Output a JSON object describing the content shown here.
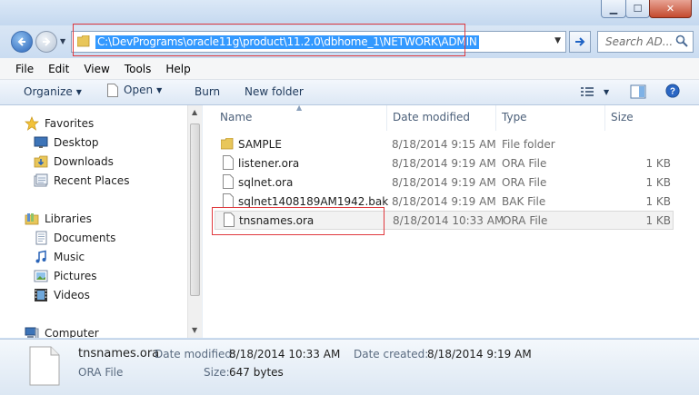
{
  "window": {
    "controls": {
      "minimize": "▁",
      "maximize": "☐",
      "close": "✕"
    }
  },
  "nav": {
    "address": "C:\\DevPrograms\\oracle11g\\product\\11.2.0\\dbhome_1\\NETWORK\\ADMIN",
    "search_placeholder": "Search AD...",
    "icons": {
      "back": "back-arrow-icon",
      "forward": "forward-arrow-icon",
      "go": "go-arrow-icon",
      "search": "magnifier-icon"
    }
  },
  "menu": [
    "File",
    "Edit",
    "View",
    "Tools",
    "Help"
  ],
  "toolbar": {
    "organize": "Organize",
    "open": "Open",
    "burn": "Burn",
    "new_folder": "New folder"
  },
  "navpane": {
    "favorites": {
      "label": "Favorites",
      "items": [
        "Desktop",
        "Downloads",
        "Recent Places"
      ]
    },
    "libraries": {
      "label": "Libraries",
      "items": [
        "Documents",
        "Music",
        "Pictures",
        "Videos"
      ]
    },
    "computer": {
      "label": "Computer"
    }
  },
  "columns": {
    "name": "Name",
    "date": "Date modified",
    "type": "Type",
    "size": "Size"
  },
  "files": [
    {
      "name": "SAMPLE",
      "date": "8/18/2014 9:15 AM",
      "type": "File folder",
      "size": "",
      "icon": "folder-icon"
    },
    {
      "name": "listener.ora",
      "date": "8/18/2014 9:19 AM",
      "type": "ORA File",
      "size": "1 KB",
      "icon": "file-icon"
    },
    {
      "name": "sqlnet.ora",
      "date": "8/18/2014 9:19 AM",
      "type": "ORA File",
      "size": "1 KB",
      "icon": "file-icon"
    },
    {
      "name": "sqlnet1408189AM1942.bak",
      "date": "8/18/2014 9:19 AM",
      "type": "BAK File",
      "size": "1 KB",
      "icon": "file-icon"
    },
    {
      "name": "tnsnames.ora",
      "date": "8/18/2014 10:33 AM",
      "type": "ORA File",
      "size": "1 KB",
      "icon": "file-icon",
      "selected": true
    }
  ],
  "details": {
    "name": "tnsnames.ora",
    "type": "ORA File",
    "date_modified_label": "Date modified:",
    "date_modified": "8/18/2014 10:33 AM",
    "date_created_label": "Date created:",
    "date_created": "8/18/2014 9:19 AM",
    "size_label": "Size:",
    "size": "647 bytes"
  },
  "colors": {
    "highlight": "#3399ff",
    "annotation_red": "#e0393e",
    "selected_row": "#f2f2f2"
  }
}
